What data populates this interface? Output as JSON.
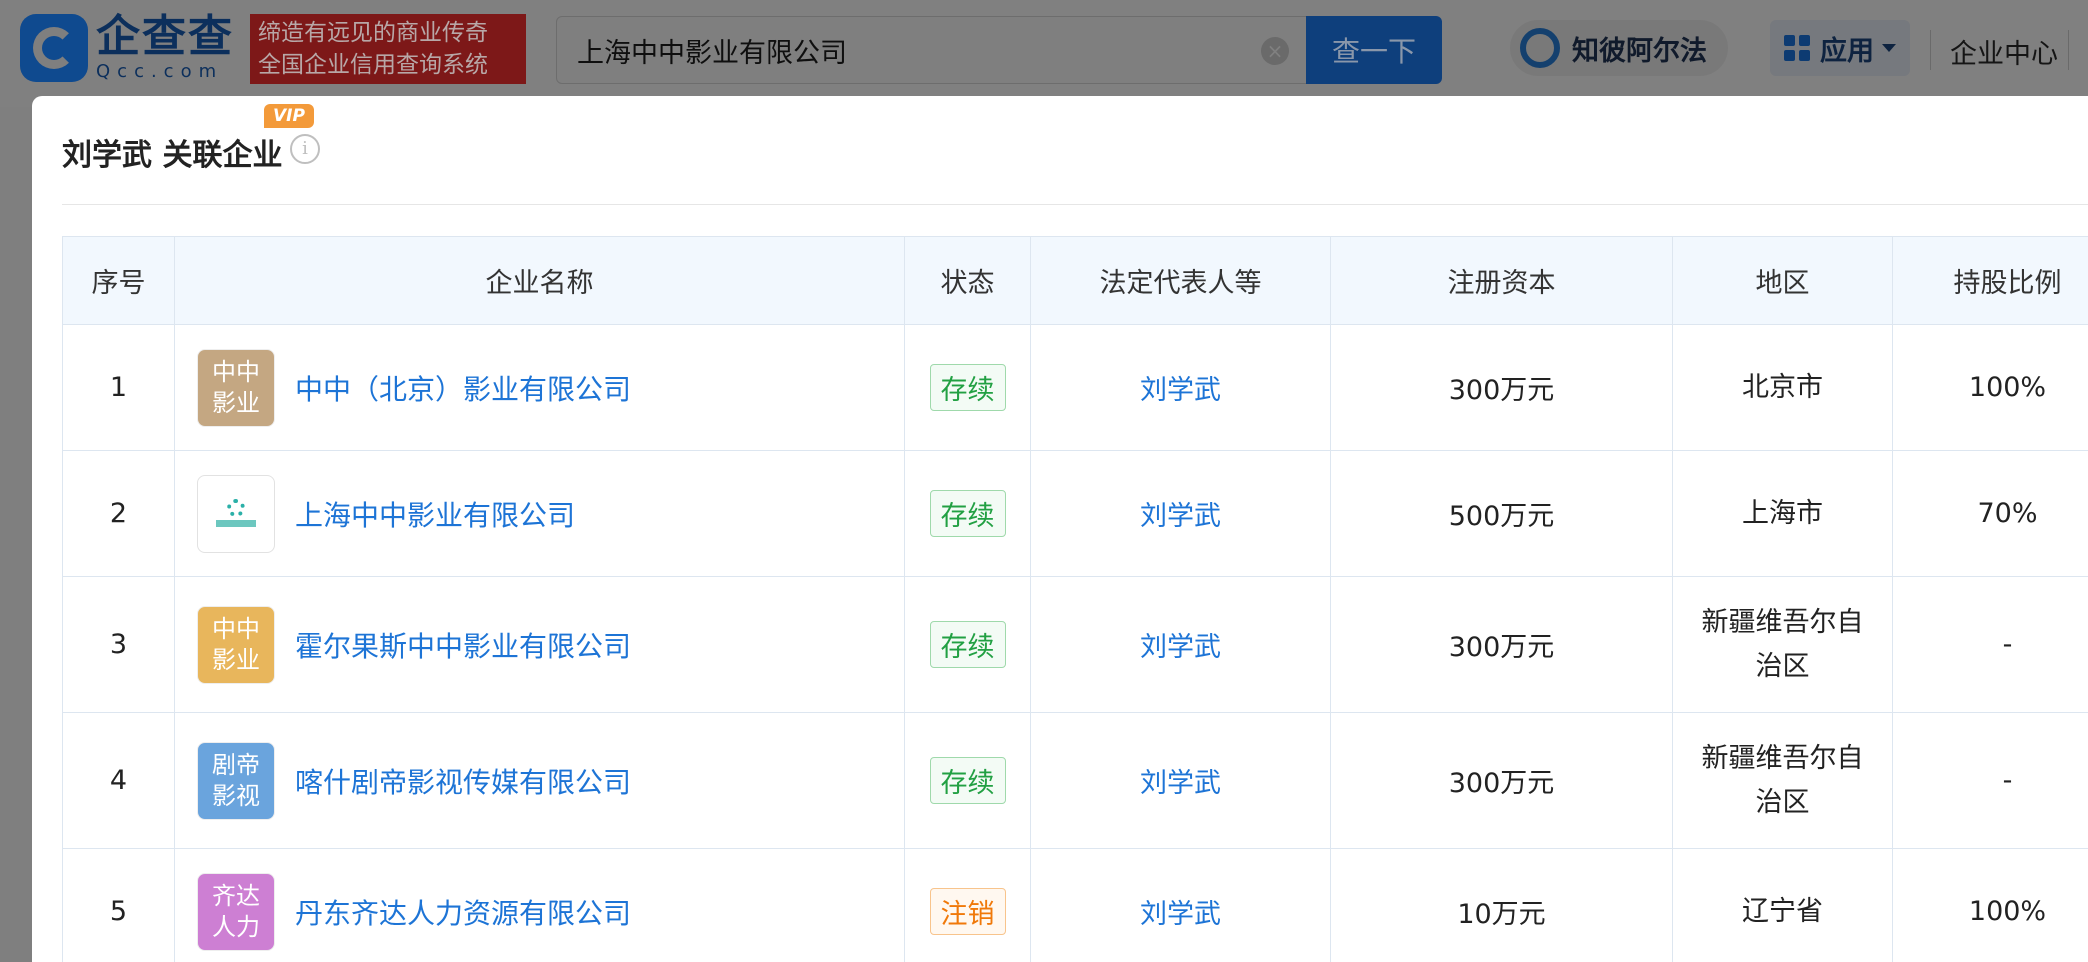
{
  "header": {
    "logo_cn": "企查查",
    "logo_en": "Qcc.com",
    "slogan_line1": "缔造有远见的商业传奇",
    "slogan_line2": "全国企业信用查询系统",
    "search_value": "上海中中影业有限公司",
    "search_button": "查一下",
    "zhibo_label": "知彼阿尔法",
    "app_label": "应用",
    "enterprise_center": "企业中心"
  },
  "modal": {
    "title": "刘学武 关联企业",
    "vip_badge": "VIP",
    "info_glyph": "i"
  },
  "table": {
    "headers": [
      "序号",
      "企业名称",
      "状态",
      "法定代表人等",
      "注册资本",
      "地区",
      "持股比例"
    ],
    "rows": [
      {
        "index": "1",
        "avatar_line1": "中中",
        "avatar_line2": "影业",
        "avatar_color": "#c4a782",
        "name": "中中（北京）影业有限公司",
        "status": "存续",
        "legal_rep": "刘学武",
        "capital": "300万元",
        "region_line1": "北京市",
        "region_line2": "",
        "share": "100%"
      },
      {
        "index": "2",
        "avatar_line1": "",
        "avatar_line2": "",
        "avatar_color": "#ffffff",
        "name": "上海中中影业有限公司",
        "status": "存续",
        "legal_rep": "刘学武",
        "capital": "500万元",
        "region_line1": "上海市",
        "region_line2": "",
        "share": "70%"
      },
      {
        "index": "3",
        "avatar_line1": "中中",
        "avatar_line2": "影业",
        "avatar_color": "#e8b65c",
        "name": "霍尔果斯中中影业有限公司",
        "status": "存续",
        "legal_rep": "刘学武",
        "capital": "300万元",
        "region_line1": "新疆维吾尔自",
        "region_line2": "治区",
        "share": "-"
      },
      {
        "index": "4",
        "avatar_line1": "剧帝",
        "avatar_line2": "影视",
        "avatar_color": "#6aa4dd",
        "name": "喀什剧帝影视传媒有限公司",
        "status": "存续",
        "legal_rep": "刘学武",
        "capital": "300万元",
        "region_line1": "新疆维吾尔自",
        "region_line2": "治区",
        "share": "-"
      },
      {
        "index": "5",
        "avatar_line1": "齐达",
        "avatar_line2": "人力",
        "avatar_color": "#cd7fd3",
        "name": "丹东齐达人力资源有限公司",
        "status": "注销",
        "legal_rep": "刘学武",
        "capital": "10万元",
        "region_line1": "辽宁省",
        "region_line2": "",
        "share": "100%"
      }
    ]
  },
  "colors": {
    "link": "#1d74d6",
    "status_active": "#22a043",
    "status_cancelled": "#f0790a",
    "header_bg": "#f2f8fe"
  }
}
